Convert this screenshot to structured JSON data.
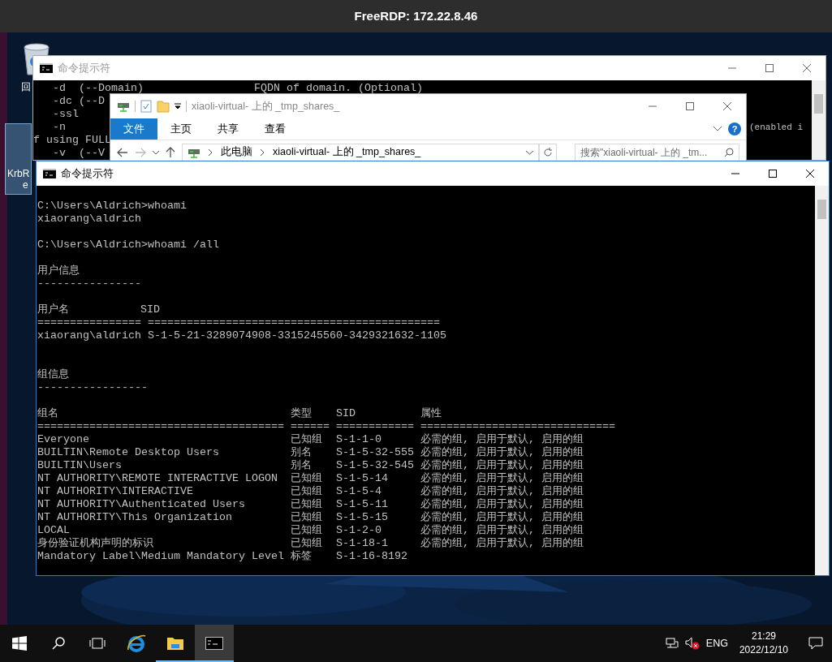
{
  "rdp_window": {
    "title": "FreeRDP: 172.22.8.46"
  },
  "desktop_icons": [
    {
      "kind": "recycle",
      "label_lines": [
        "回"
      ]
    },
    {
      "kind": "app",
      "label_lines": [
        "KrbR",
        "e"
      ],
      "selected": true
    }
  ],
  "back_console": {
    "title": "命令提示符",
    "active": false,
    "lines": [
      {
        "left": "   -d  (--Domain)                 FQDN of domain. (Optional)"
      },
      {
        "left": "   -dc (--D"
      },
      {
        "left": "   -ssl"
      },
      {
        "left": "   -n",
        "right": "(enabled i"
      },
      {
        "left": "f using FULL"
      },
      {
        "left": "   -v  (--V"
      }
    ]
  },
  "explorer": {
    "title": "xiaoli-virtual- 上的 _tmp_shares_",
    "active": false,
    "tabs": [
      {
        "label": "文件",
        "selected": true
      },
      {
        "label": "主页",
        "selected": false
      },
      {
        "label": "共享",
        "selected": false
      },
      {
        "label": "查看",
        "selected": false
      }
    ],
    "help": "?",
    "breadcrumb": [
      "此电脑",
      "xiaoli-virtual- 上的 _tmp_shares_"
    ],
    "search": {
      "placeholder": "搜索\"xiaoli-virtual- 上的 _tm..."
    }
  },
  "console": {
    "title": "命令提示符",
    "active": true,
    "lines": [
      {
        "kind": "text",
        "text": "C:\\Users\\Aldrich>whoami"
      },
      {
        "kind": "text",
        "text": "xiaorang\\aldrich"
      },
      {
        "kind": "blank"
      },
      {
        "kind": "text",
        "text": "C:\\Users\\Aldrich>whoami /all"
      },
      {
        "kind": "blank"
      },
      {
        "kind": "text",
        "text": "用户信息"
      },
      {
        "kind": "text",
        "text": "----------------"
      },
      {
        "kind": "blank"
      },
      {
        "kind": "text",
        "text": "用户名           SID"
      },
      {
        "kind": "text",
        "text": "================ ============================================="
      },
      {
        "kind": "text",
        "text": "xiaorang\\aldrich S-1-5-21-3289074908-3315245560-3429321632-1105"
      },
      {
        "kind": "blank"
      },
      {
        "kind": "blank"
      },
      {
        "kind": "text",
        "text": "组信息"
      },
      {
        "kind": "text",
        "text": "-----------------"
      },
      {
        "kind": "blank"
      }
    ],
    "group_table": {
      "columns": [
        "组名",
        "类型",
        "SID",
        "属性"
      ],
      "separator": [
        "======================================",
        "======",
        "============",
        "=============================="
      ],
      "rows": [
        [
          "Everyone",
          "已知组",
          "S-1-1-0",
          "必需的组, 启用于默认, 启用的组"
        ],
        [
          "BUILTIN\\Remote Desktop Users",
          "别名",
          "S-1-5-32-555",
          "必需的组, 启用于默认, 启用的组"
        ],
        [
          "BUILTIN\\Users",
          "别名",
          "S-1-5-32-545",
          "必需的组, 启用于默认, 启用的组"
        ],
        [
          "NT AUTHORITY\\REMOTE INTERACTIVE LOGON",
          "已知组",
          "S-1-5-14",
          "必需的组, 启用于默认, 启用的组"
        ],
        [
          "NT AUTHORITY\\INTERACTIVE",
          "已知组",
          "S-1-5-4",
          "必需的组, 启用于默认, 启用的组"
        ],
        [
          "NT AUTHORITY\\Authenticated Users",
          "已知组",
          "S-1-5-11",
          "必需的组, 启用于默认, 启用的组"
        ],
        [
          "NT AUTHORITY\\This Organization",
          "已知组",
          "S-1-5-15",
          "必需的组, 启用于默认, 启用的组"
        ],
        [
          "LOCAL",
          "已知组",
          "S-1-2-0",
          "必需的组, 启用于默认, 启用的组"
        ],
        [
          "身份验证机构声明的标识",
          "已知组",
          "S-1-18-1",
          "必需的组, 启用于默认, 启用的组"
        ],
        [
          "Mandatory Label\\Medium Mandatory Level",
          "标签",
          "S-1-16-8192"
        ]
      ]
    }
  },
  "taskbar": {
    "apps": [
      {
        "kind": "browser",
        "running": false,
        "selected": false
      },
      {
        "kind": "folder",
        "running": true,
        "selected": false
      },
      {
        "kind": "console",
        "running": true,
        "selected": true
      }
    ],
    "language": "ENG",
    "time": "21:29",
    "date": "2022/12/10"
  }
}
